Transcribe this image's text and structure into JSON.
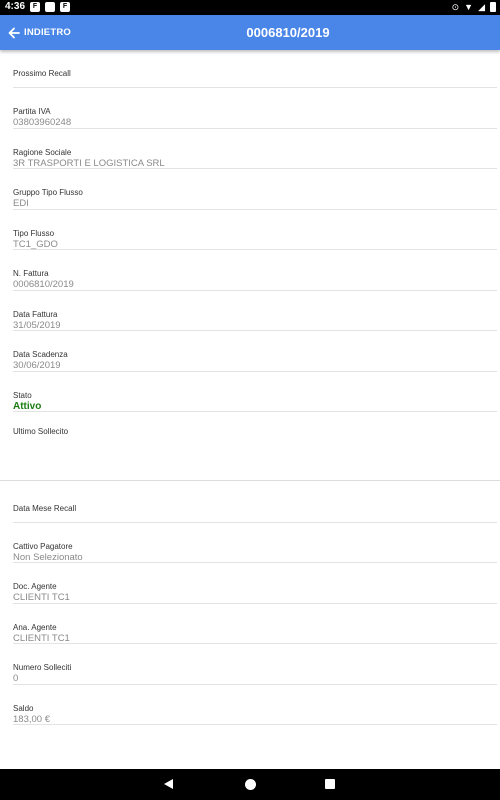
{
  "status_bar": {
    "time": "4:36",
    "left_icons": [
      "F",
      "note",
      "F"
    ],
    "right_icons": [
      "location-icon",
      "wifi-icon",
      "signal-icon",
      "battery-icon"
    ]
  },
  "app_bar": {
    "back_label": "INDIETRO",
    "title": "0006810/2019",
    "color": "#4a86e8"
  },
  "fields": [
    {
      "label": "Prossimo Recall",
      "value": ""
    },
    {
      "label": "Partita IVA",
      "value": "03803960248"
    },
    {
      "label": "Ragione Sociale",
      "value": "3R TRASPORTI E LOGISTICA SRL"
    },
    {
      "label": "Gruppo Tipo Flusso",
      "value": "EDI"
    },
    {
      "label": "Tipo Flusso",
      "value": "TC1_GDO"
    },
    {
      "label": "N. Fattura",
      "value": "0006810/2019"
    },
    {
      "label": "Data Fattura",
      "value": "31/05/2019"
    },
    {
      "label": "Data Scadenza",
      "value": "30/06/2019"
    },
    {
      "label": "Stato",
      "value": "Attivo"
    },
    {
      "label": "Ultimo Sollecito",
      "value": ""
    },
    {
      "label": "Data Mese Recall",
      "value": ""
    },
    {
      "label": "Cattivo Pagatore",
      "value": "Non Selezionato"
    },
    {
      "label": "Doc. Agente",
      "value": "CLIENTI TC1"
    },
    {
      "label": "Ana. Agente",
      "value": "CLIENTI TC1"
    },
    {
      "label": "Numero Solleciti",
      "value": "0"
    },
    {
      "label": "Saldo",
      "value": "183,00 €"
    }
  ],
  "colors": {
    "status_active": "#1b7d12",
    "value_text": "#8a8a8a",
    "label_text": "#333333"
  }
}
